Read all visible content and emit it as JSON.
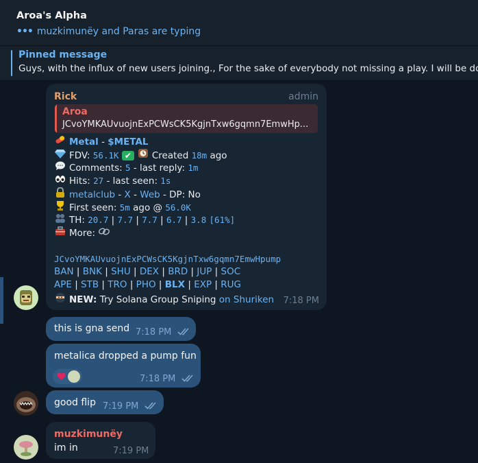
{
  "header": {
    "title": "Aroa's Alpha",
    "typing": "muzkimunëy and Paras are typing"
  },
  "pinned": {
    "label": "Pinned message",
    "text": "Guys, with the influx of new users joining.,  For the sake of everybody not missing a play.  I will be do"
  },
  "bot_message": {
    "sender": "Rick",
    "badge": "admin",
    "reply": {
      "name": "Aroa",
      "text": "JCvoYMKAUvuojnExPCWsCK5KgjnTxw6gqmn7EmwHp..."
    },
    "token_name": "Metal",
    "token_symbol": "$METAL",
    "fdv_label": "FDV:",
    "fdv": "56.1K",
    "created_label": "Created",
    "created_ago": "18m",
    "ago": "ago",
    "comments_label": "Comments:",
    "comments": "5",
    "last_reply_label": "- last reply:",
    "last_reply": "1m",
    "hits_label": "Hits:",
    "hits": "27",
    "last_seen_label": "- last seen:",
    "last_seen": "1s",
    "social": "metalclub",
    "x_link": "X",
    "web_link": "Web",
    "dp_text": "- DP: No",
    "first_seen_label": "First seen:",
    "first_seen": "5m",
    "first_seen_mid": "ago @",
    "first_seen_mc": "56.0K",
    "th_label": "TH:",
    "th_values": [
      "20.7",
      "7.7",
      "7.7",
      "6.7",
      "3.8"
    ],
    "th_total": "[61%]",
    "more_label": "More:",
    "contract": "JCvoYMKAUvuojnExPCWsCK5KgjnTxw6gqmn7EmwHpump",
    "links_row1": [
      "BAN",
      "BNK",
      "SHU",
      "DEX",
      "BRD",
      "JUP",
      "SOC"
    ],
    "links_row2": [
      "APE",
      "STB",
      "TRO",
      "PHO",
      "BLX",
      "EXP",
      "RUG"
    ],
    "promo_new": "NEW:",
    "promo_text": "Try Solana Group Sniping",
    "promo_link": "on Shuriken",
    "time": "7:18 PM"
  },
  "messages": [
    {
      "text": "this is gna send",
      "time": "7:18 PM"
    },
    {
      "text": "metalica dropped a pump fun",
      "time": "7:18 PM"
    },
    {
      "text": "good flip",
      "time": "7:19 PM"
    }
  ],
  "last_message": {
    "sender": "muzkimunëy",
    "text": "im in",
    "time": "7:19 PM"
  },
  "colors": {
    "background": "#0e1621",
    "header": "#17212b",
    "incoming_bubble": "#182533",
    "outgoing_bubble": "#2b5278",
    "accent": "#6ab3f3",
    "sender_rick": "#e3a068",
    "sender_muzki": "#ee6a63"
  },
  "icons": [
    "pill-icon",
    "gem-icon",
    "check-icon",
    "clock-icon",
    "speech-icon",
    "eyes-icon",
    "lock-icon",
    "trophy-icon",
    "people-icon",
    "toolbox-icon",
    "link-icon",
    "ninja-icon",
    "heart-icon",
    "double-check-icon"
  ]
}
